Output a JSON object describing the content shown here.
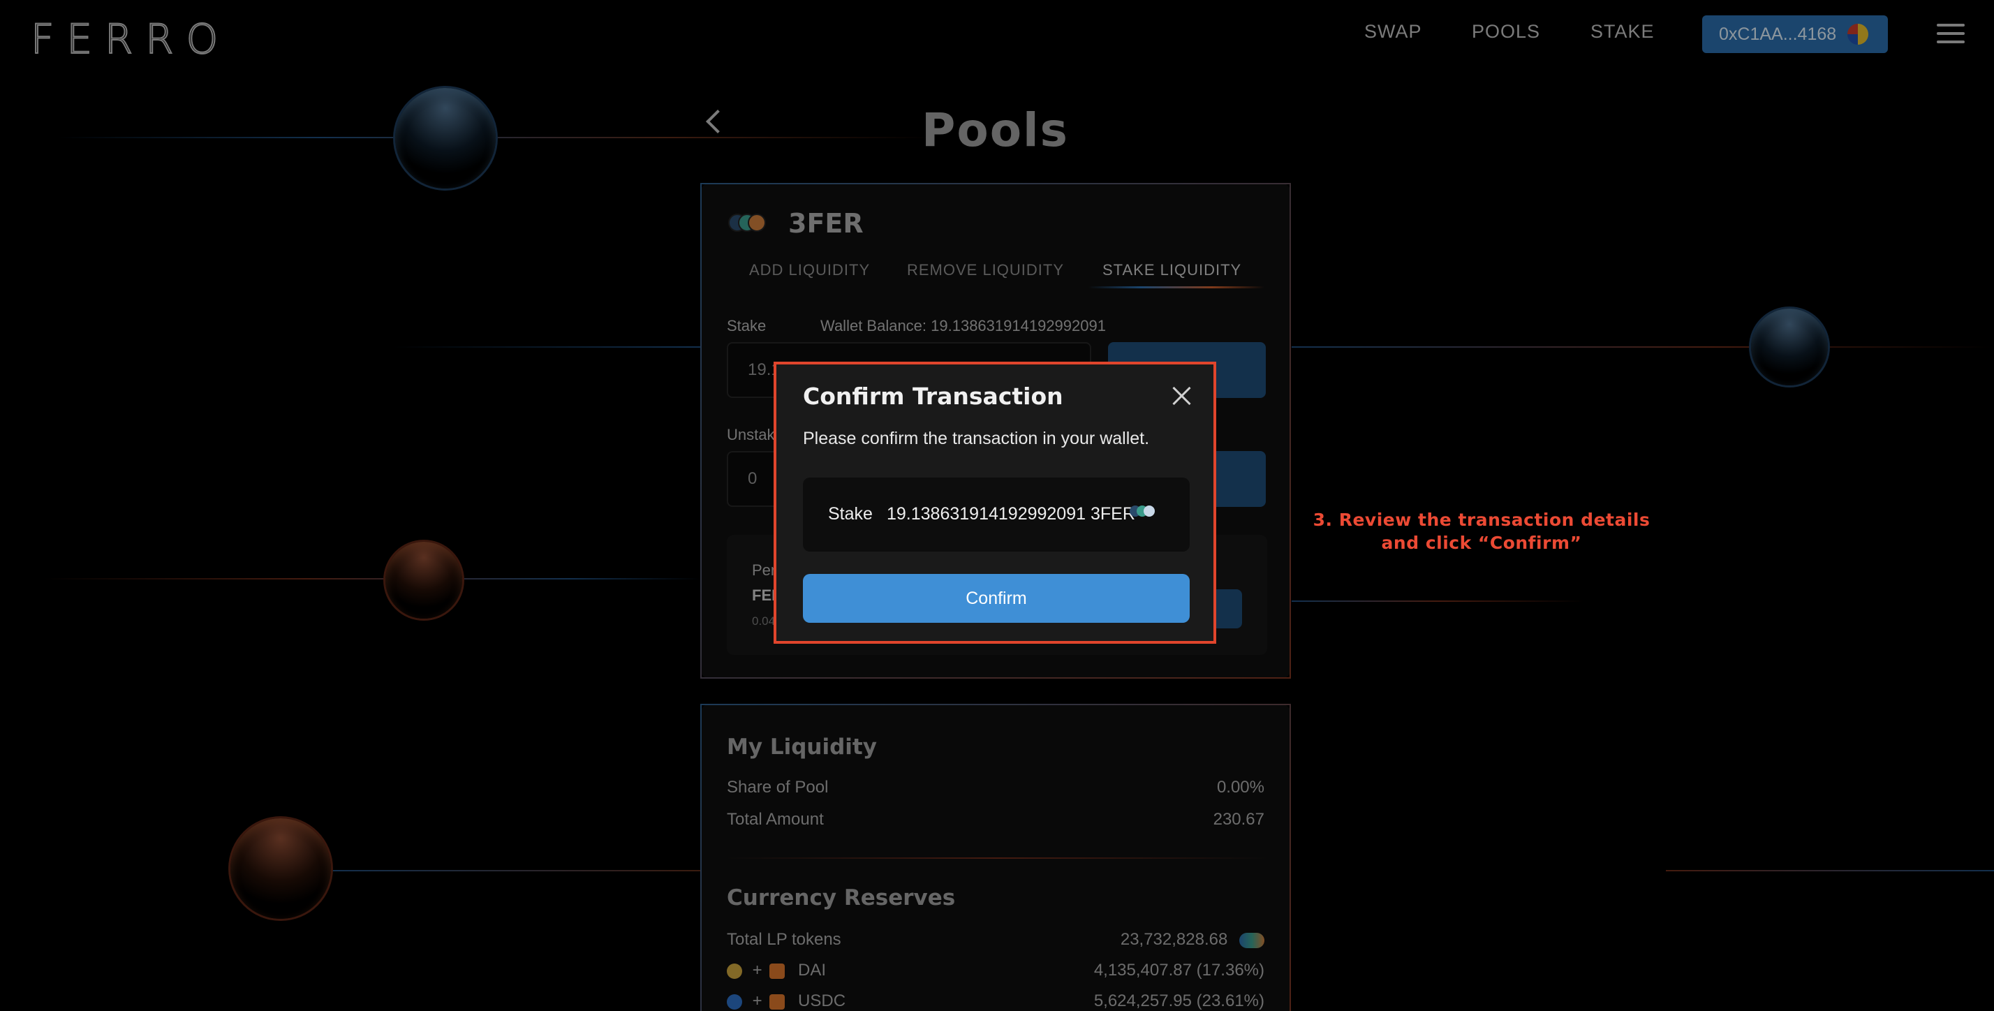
{
  "header": {
    "logo": "FERRO",
    "nav": [
      {
        "label": "SWAP"
      },
      {
        "label": "POOLS"
      },
      {
        "label": "STAKE"
      }
    ],
    "wallet_address": "0xC1AA...4168"
  },
  "page": {
    "title": "Pools"
  },
  "pool_card": {
    "name": "3FER",
    "tabs": [
      {
        "label": "ADD LIQUIDITY"
      },
      {
        "label": "REMOVE LIQUIDITY"
      },
      {
        "label": "STAKE LIQUIDITY"
      }
    ],
    "active_tab": "STAKE LIQUIDITY",
    "stake_label": "Stake",
    "wallet_balance": "Wallet Balance: 19.138631914192992091",
    "stake_input_value": "19.1",
    "unstake_label": "Unstak",
    "unstake_input_value": "0",
    "reward_label": "Per",
    "reward_token": "FEI",
    "reward_amount": "0.04"
  },
  "liquidity": {
    "title": "My Liquidity",
    "rows": [
      {
        "label": "Share of Pool",
        "value": "0.00%"
      },
      {
        "label": "Total Amount",
        "value": "230.67"
      }
    ]
  },
  "reserves": {
    "title": "Currency Reserves",
    "total_label": "Total LP tokens",
    "total_value": "23,732,828.68",
    "coins": [
      {
        "name": "DAI",
        "value": "4,135,407.87 (17.36%)",
        "color": "#c8a23c"
      },
      {
        "name": "USDC",
        "value": "5,624,257.95 (23.61%)",
        "color": "#2b6cbf"
      }
    ]
  },
  "modal": {
    "title": "Confirm Transaction",
    "message": "Please confirm the transaction in your wallet.",
    "detail_label": "Stake",
    "detail_value": "19.138631914192992091 3FER",
    "confirm_label": "Confirm"
  },
  "annotation": {
    "line1": "3. Review the transaction details",
    "line2": "and click “Confirm”"
  },
  "colors": {
    "accent_blue": "#3f8fd6",
    "highlight_red": "#e0452c",
    "background": "#000000"
  }
}
